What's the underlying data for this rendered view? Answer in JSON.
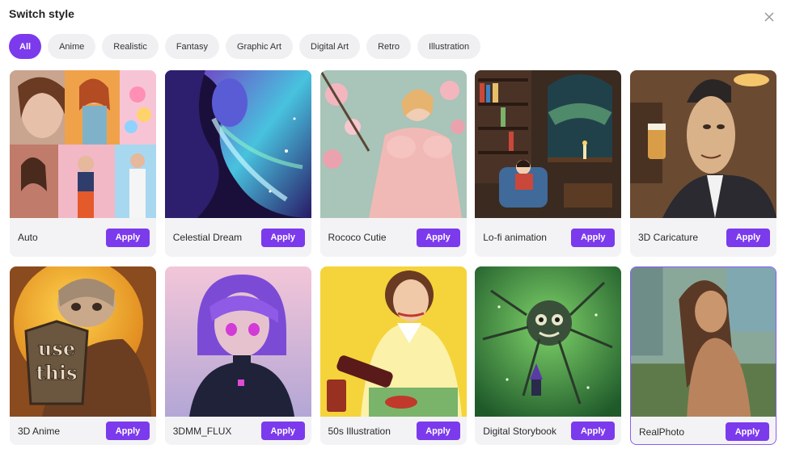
{
  "dialog": {
    "title": "Switch style",
    "close_icon": "close-icon"
  },
  "tabs": [
    {
      "label": "All",
      "active": true
    },
    {
      "label": "Anime"
    },
    {
      "label": "Realistic"
    },
    {
      "label": "Fantasy"
    },
    {
      "label": "Graphic Art"
    },
    {
      "label": "Digital Art"
    },
    {
      "label": "Retro"
    },
    {
      "label": "Illustration"
    }
  ],
  "styles": [
    {
      "name": "Auto",
      "apply_label": "Apply"
    },
    {
      "name": "Celestial Dream",
      "apply_label": "Apply"
    },
    {
      "name": "Rococo Cutie",
      "apply_label": "Apply"
    },
    {
      "name": "Lo-fi animation",
      "apply_label": "Apply"
    },
    {
      "name": "3D Caricature",
      "apply_label": "Apply"
    },
    {
      "name": "3D Anime",
      "apply_label": "Apply"
    },
    {
      "name": "3DMM_FLUX",
      "apply_label": "Apply"
    },
    {
      "name": "50s Illustration",
      "apply_label": "Apply"
    },
    {
      "name": "Digital Storybook",
      "apply_label": "Apply"
    },
    {
      "name": "RealPhoto",
      "apply_label": "Apply",
      "selected": true
    }
  ],
  "thumb_sign_text": [
    "use",
    "this"
  ],
  "colors": {
    "accent": "#7c3aed",
    "tab_bg": "#f0f0f3",
    "card_bg": "#f3f3f5"
  }
}
